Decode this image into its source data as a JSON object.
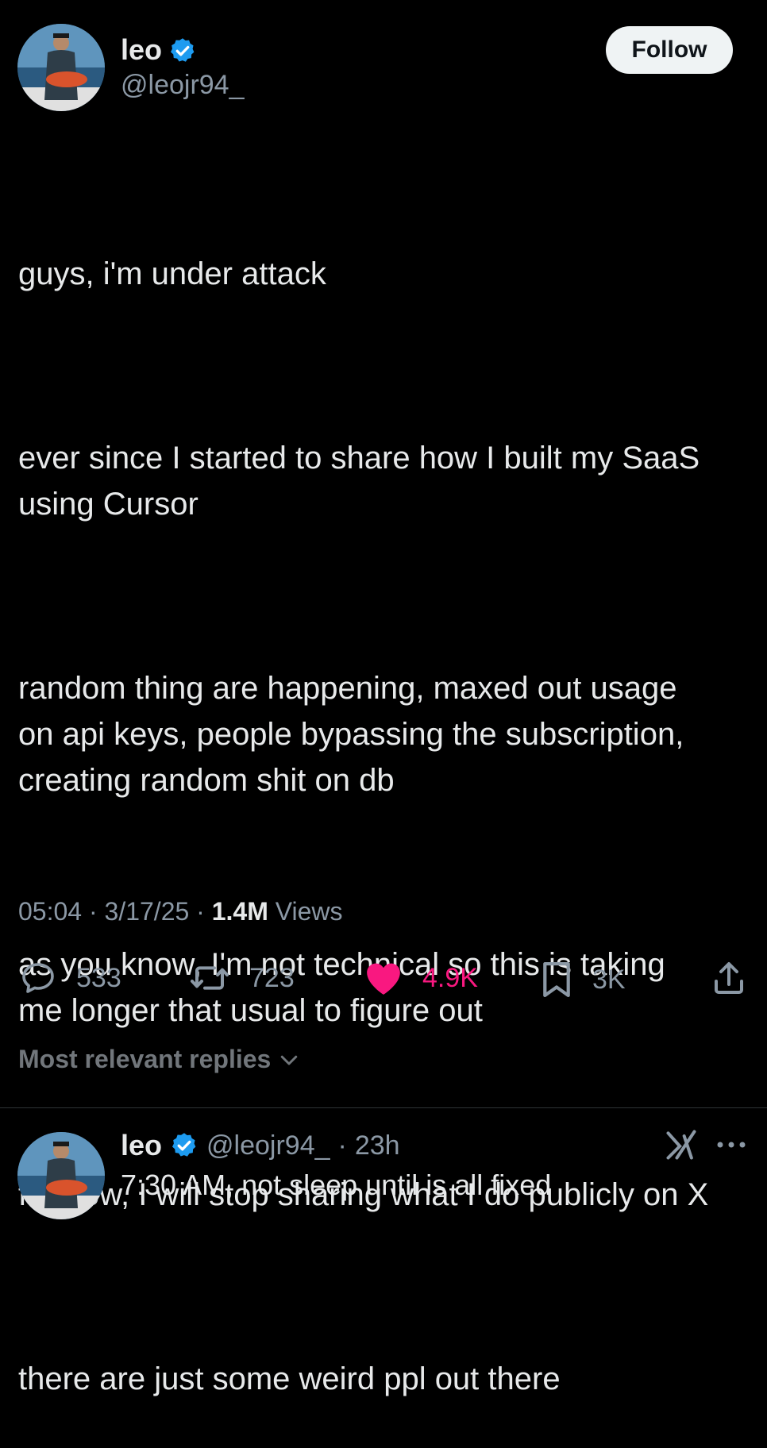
{
  "author": {
    "name": "leo",
    "handle": "@leojr94_",
    "verified": true
  },
  "follow_label": "Follow",
  "tweet": {
    "paragraphs": [
      "guys, i'm under attack",
      "ever since I started to share how I built my SaaS\nusing Cursor",
      "random thing are happening, maxed out usage\non api keys, people bypassing the subscription,\ncreating random shit on db",
      "as you know, I'm not technical so this is taking\nme longer that usual to figure out",
      "for now, I will stop sharing what I do publicly on X",
      "there are just some weird ppl out there"
    ],
    "time": "05:04",
    "date": "3/17/25",
    "views_count": "1.4M",
    "views_label": "Views"
  },
  "actions": {
    "replies": "533",
    "reposts": "723",
    "likes": "4.9K",
    "bookmarks": "3K"
  },
  "replies_header": "Most relevant replies",
  "reply": {
    "name": "leo",
    "handle": "@leojr94_",
    "age": "23h",
    "text": "7:30 AM, not sleep until is all fixed"
  },
  "colors": {
    "background": "#000000",
    "text": "#e7e9ea",
    "secondary": "#8b98a5",
    "like": "#f91880",
    "verified": "#1d9bf0"
  }
}
